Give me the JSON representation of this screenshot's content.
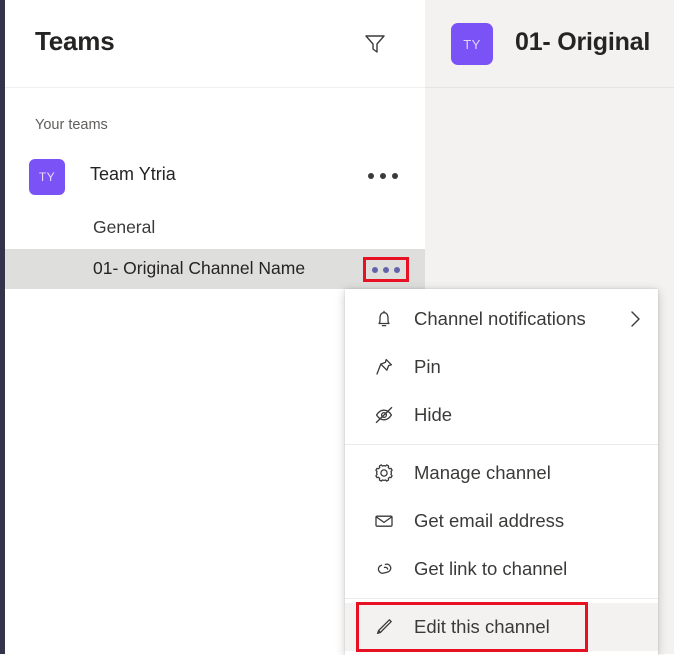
{
  "colors": {
    "accent_purple": "#7b52f5",
    "menu_dots_purple": "#6264a7",
    "annotation_red": "#e81123",
    "panel_bg": "#f3f2f1",
    "selected_row_bg": "#dededd",
    "app_rail": "#33344a"
  },
  "sidebar": {
    "title": "Teams",
    "filter_icon": "filter-icon",
    "section_label": "Your teams",
    "team": {
      "avatar_initials": "TY",
      "name": "Team Ytria",
      "more_icon": "more-options-icon"
    },
    "channels": [
      {
        "name": "General",
        "selected": false
      },
      {
        "name": "01- Original Channel Name",
        "selected": true,
        "more_icon": "more-options-icon"
      }
    ]
  },
  "content": {
    "avatar_initials": "TY",
    "title": "01- Original"
  },
  "context_menu": {
    "groups": [
      {
        "items": [
          {
            "label": "Channel notifications",
            "icon": "bell-icon",
            "submenu": true,
            "chevron_icon": "chevron-right-icon",
            "hovered": false,
            "annotated": false
          },
          {
            "label": "Pin",
            "icon": "pin-icon",
            "submenu": false,
            "hovered": false,
            "annotated": false
          },
          {
            "label": "Hide",
            "icon": "hide-eye-icon",
            "submenu": false,
            "hovered": false,
            "annotated": false
          }
        ]
      },
      {
        "items": [
          {
            "label": "Manage channel",
            "icon": "gear-icon",
            "submenu": false,
            "hovered": false,
            "annotated": false
          },
          {
            "label": "Get email address",
            "icon": "envelope-icon",
            "submenu": false,
            "hovered": false,
            "annotated": false
          },
          {
            "label": "Get link to channel",
            "icon": "link-icon",
            "submenu": false,
            "hovered": false,
            "annotated": false
          }
        ]
      },
      {
        "items": [
          {
            "label": "Edit this channel",
            "icon": "pencil-icon",
            "submenu": false,
            "hovered": true,
            "annotated": true
          }
        ]
      }
    ]
  }
}
